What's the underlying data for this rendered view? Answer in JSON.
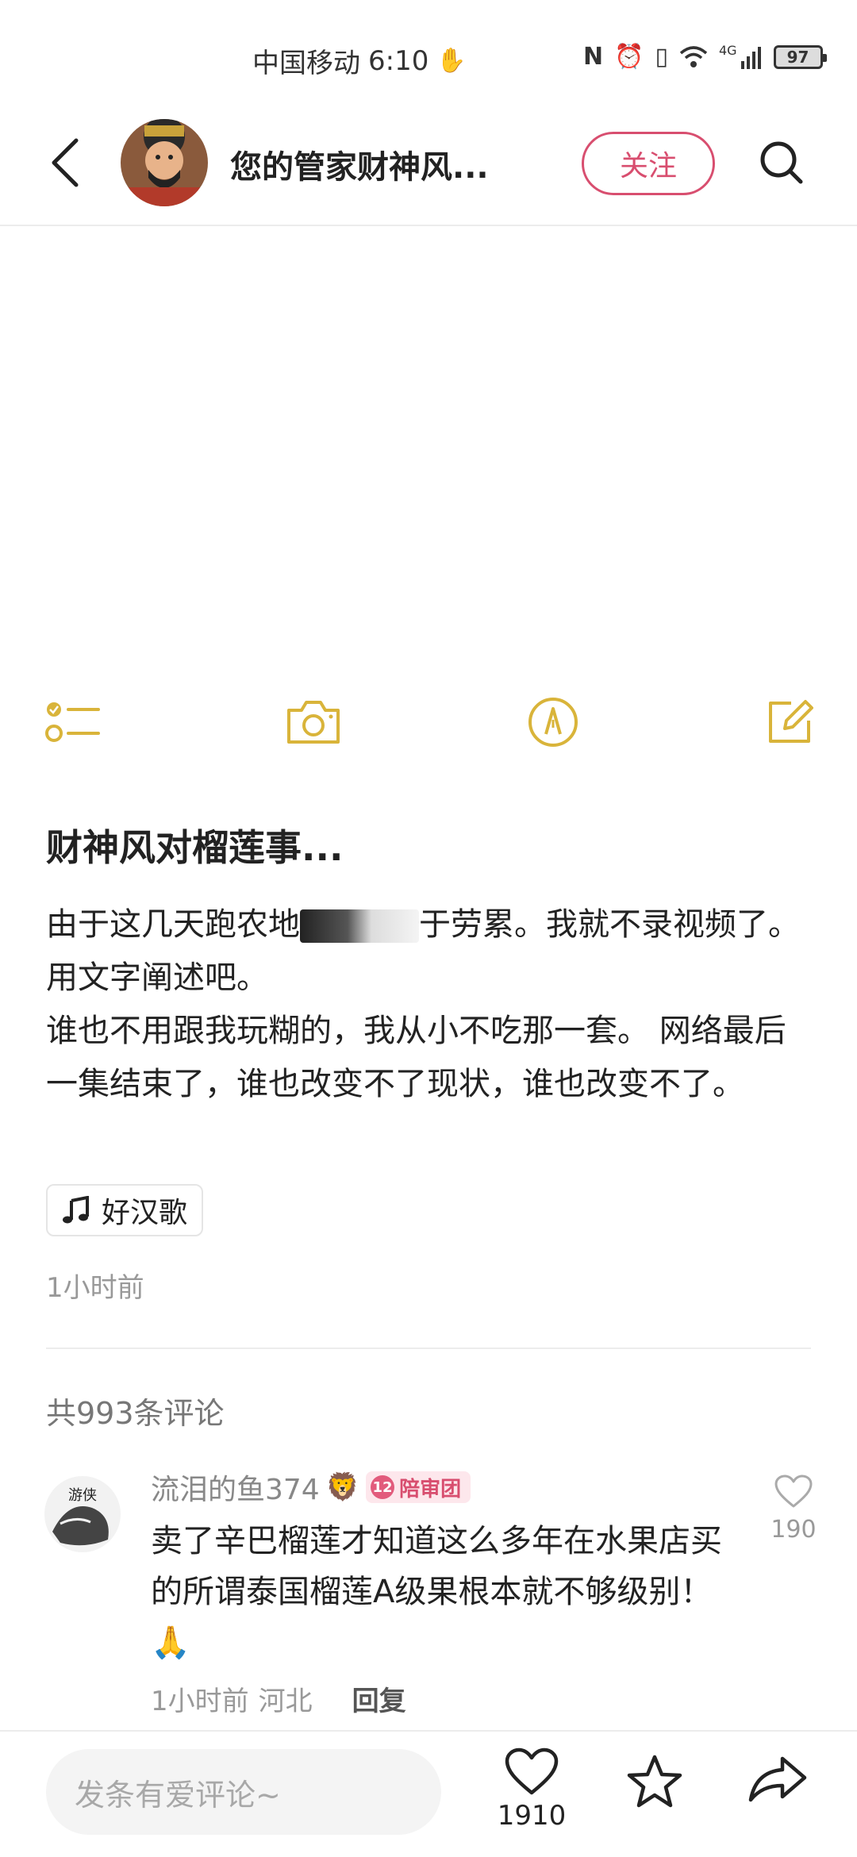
{
  "status_bar": {
    "carrier": "中国移动",
    "time": "6:10",
    "network": "4G",
    "battery": "97"
  },
  "header": {
    "author_name": "您的管家财神风...",
    "follow_label": "关注",
    "icons": [
      "back-arrow-icon",
      "search-icon"
    ]
  },
  "media_tools": [
    "checklist-icon",
    "camera-icon",
    "pen-icon",
    "edit-icon"
  ],
  "post": {
    "title": "财神风对榴莲事...",
    "body_line1_start": "由于这几天跑农地",
    "body_line1_end": "于劳累。我就不录视频了。用文字阐述吧。",
    "body_line2": "谁也不用跟我玩糊的，我从小不吃那一套。 网络最后一集结束了，谁也改变不了现状，谁也改变不了。",
    "music_tag": "好汉歌",
    "time": "1小时前"
  },
  "comments_section": {
    "count_label": "共993条评论",
    "comments": [
      {
        "user": "流泪的鱼374",
        "badge_level": "12",
        "badge_label": "陪审团",
        "text": "卖了辛巴榴莲才知道这么多年在水果店买的所谓泰国榴莲A级果根本就不够级别！",
        "time": "1小时前",
        "location": "河北",
        "reply_label": "回复",
        "likes": "190"
      }
    ]
  },
  "bottom_bar": {
    "comment_placeholder": "发条有爱评论~",
    "like_count": "1910"
  },
  "colors": {
    "accent_pink": "#d84e6f",
    "tool_yellow": "#d9b43a",
    "muted_text": "#999999"
  }
}
